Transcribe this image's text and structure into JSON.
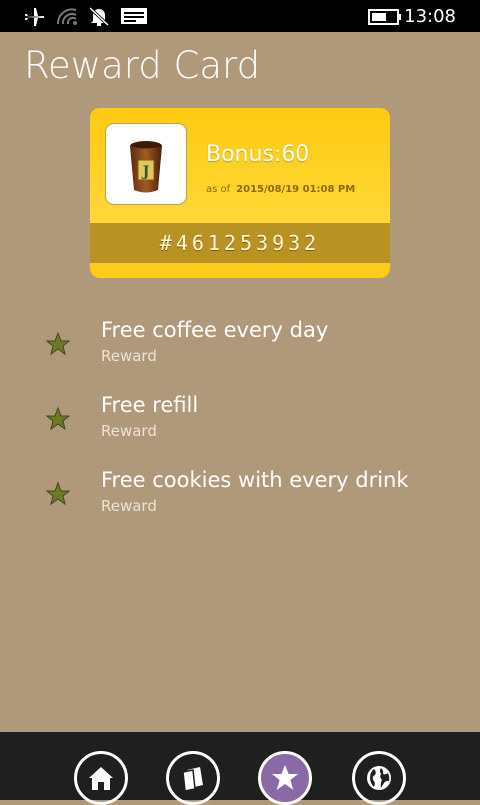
{
  "status_bar": {
    "time": "13:08",
    "icons": [
      "airplane-icon",
      "wifi-icon",
      "quiet-hours-icon",
      "notification-icon",
      "battery-icon"
    ]
  },
  "page": {
    "title": "Reward Card"
  },
  "card": {
    "bonus": "Bonus:60",
    "as_of_label": "as of",
    "as_of_date": "2015/08/19 01:08 PM",
    "number": "#461253932",
    "logo_letter": "J",
    "colors": {
      "card": "#ffcc1a",
      "band": "#b89222"
    }
  },
  "rewards": [
    {
      "title": "Free coffee every day",
      "subtitle": "Reward"
    },
    {
      "title": "Free refill",
      "subtitle": "Reward"
    },
    {
      "title": "Free cookies with every drink",
      "subtitle": "Reward"
    }
  ],
  "app_bar": {
    "buttons": [
      {
        "icon": "home-icon"
      },
      {
        "icon": "cards-icon"
      },
      {
        "icon": "star-icon",
        "active": true
      },
      {
        "icon": "globe-icon"
      }
    ],
    "active_color": "#8a6aa6"
  }
}
